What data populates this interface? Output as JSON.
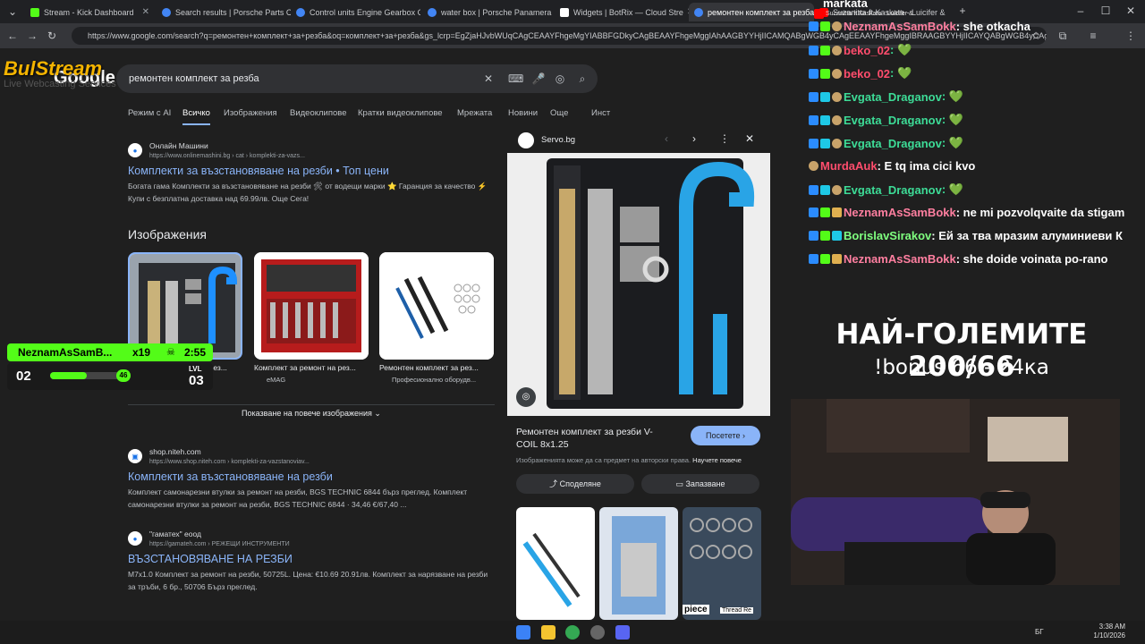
{
  "tabs": [
    {
      "label": "Stream - Kick Dashboard",
      "color": "#53fc18"
    },
    {
      "label": "Search results | Porsche Parts C",
      "color": "#4285f4"
    },
    {
      "label": "Control units Engine Gearbox C",
      "color": "#4285f4"
    },
    {
      "label": "water box | Porsche Panamera",
      "color": "#4285f4"
    },
    {
      "label": "Widgets | BotRix — Cloud Stre",
      "color": "#ffffff"
    },
    {
      "label": "ремонтен комплект за резба",
      "color": "#4285f4"
    },
    {
      "label": "Suzanitta ft.Kaskata - Luicifer &",
      "color": "#ff0000"
    }
  ],
  "url": "https://www.google.com/search?q=ремонтен+комплект+за+резба&oq=комплект+за+резба&gs_lcrp=EgZjaHJvbWUqCAgCEAAYFhgeMgYIABBFGDkyCAgBEAAYFhgeMggIAhAAGBYYHjIICAMQABgWGB4yCAgEEAAYFhgeMggIBRAAGBYYHjIICAYQABgWGB4yCAgHEAAYFhgeMgo...",
  "logo": {
    "line1": "BulStream",
    "line2": "Live Webcasting Services"
  },
  "search": {
    "query": "ремонтен комплект за резба"
  },
  "gtabs": [
    "Режим с AI",
    "Всичко",
    "Изображения",
    "Видеоклипове",
    "Кратки видеоклипове",
    "Мрежата",
    "Новини",
    "Още",
    "Инст"
  ],
  "results": [
    {
      "site": "Онлайн Машини",
      "url": "https://www.onlinemashini.bg › cat › komplekti-za-vazs...",
      "title": "Комплекти за възстановяване на резби • Топ цени",
      "snippet": "Богата гама Комплекти за възстановяване на резби 🛠 от водещи марки ⭐ Гаранция за качество ⚡ Купи с безплатна доставка над 69.99лв. Още Сега!"
    },
    {
      "site": "shop.niteh.com",
      "url": "https://www.shop.niteh.com › komplekti-za-vazstanoviav...",
      "title": "Комплекти за възстановяване на резби",
      "snippet": "Комплект самонарезни втулки за ремонт на резби, BGS TECHNIC 6844 бърз преглед. Комплект самонарезни втулки за ремонт на резби, BGS TECHNIC 6844 · 34,46 €/67,40 ..."
    },
    {
      "site": "\"гаматех\" еоод",
      "url": "https://gamateh.com › РЕЖЕЩИ ИНСТРУМЕНТИ",
      "title": "ВЪЗСТАНОВЯВАНЕ НА РЕЗБИ",
      "snippet": "M7x1.0 Комплект за ремонт на резби, 50725L. Цена: €10.69 20.91лв. Комплект за нарязване на резби за тръби, 6 бр., 50706 Бърз преглед."
    }
  ],
  "images_heading": "Изображения",
  "images": [
    {
      "caption": "Ремонтен комплект за рез...",
      "source": "Servo.bg"
    },
    {
      "caption": "Комплект за ремонт на рез...",
      "source": "eMAG"
    },
    {
      "caption": "Ремонтен комплект за рез...",
      "source": "Професионално оборудв..."
    }
  ],
  "more_images": "Показване на повече изображения",
  "side_panel": {
    "source": "Servo.bg",
    "title": "Ремонтен комплект за резби V-COIL 8x1.25",
    "visit": "Посетете",
    "note": "Изображенията може да са предмет на авторски права.",
    "learn_more": "Научете повече",
    "share": "Споделяне",
    "save": "Запазване",
    "thumb_label": "piece",
    "thumb_label2": "Thread Re"
  },
  "chat": [
    {
      "user": "markata",
      "msg": "",
      "color": "#ffffff"
    },
    {
      "user": "Suzanitta ft.Kaskata - Luicifer &",
      "msg": "",
      "color": "#ffffff"
    },
    {
      "user": "NeznamAsSamBokk",
      "msg": ": she otkacha",
      "color": "#ff7fa0"
    },
    {
      "user": "beko_02",
      "msg": ": 💚",
      "color": "#ff4d6d"
    },
    {
      "user": "beko_02",
      "msg": ": 💚",
      "color": "#ff4d6d"
    },
    {
      "user": "Evgata_Draganov",
      "msg": ": 💚",
      "color": "#3ddc97"
    },
    {
      "user": "Evgata_Draganov",
      "msg": ": 💚",
      "color": "#3ddc97"
    },
    {
      "user": "Evgata_Draganov",
      "msg": ": 💚",
      "color": "#3ddc97"
    },
    {
      "user": "MurdaAuk",
      "msg": ": E tq ima cici kvo",
      "color": "#ff4d6d"
    },
    {
      "user": "Evgata_Draganov",
      "msg": ": 💚",
      "color": "#3ddc97"
    },
    {
      "user": "NeznamAsSamBokk",
      "msg": ": ne mi pozvolqvaite da stigam",
      "color": "#ff7fa0"
    },
    {
      "user": "BorislavSirakov",
      "msg": ": Ей за тва мразим алуминиеви К",
      "color": "#7fff7f"
    },
    {
      "user": "NeznamAsSamBokk",
      "msg": ": she doide voinata po-rano",
      "color": "#ff7fa0"
    }
  ],
  "banner": {
    "title": "НАЙ-ГОЛЕМИТЕ 200/66",
    "bonus": "!bonus 66 - 24ка"
  },
  "level_widget": {
    "user": "NeznamAsSamB...",
    "count": "x19",
    "timer": "2:55",
    "level_from": "02",
    "level_to": "03",
    "progress": "46",
    "lvl_label": "LVL"
  },
  "taskbar": {
    "lang": "БГ",
    "time": "3:38 AM",
    "date": "1/10/2026"
  }
}
